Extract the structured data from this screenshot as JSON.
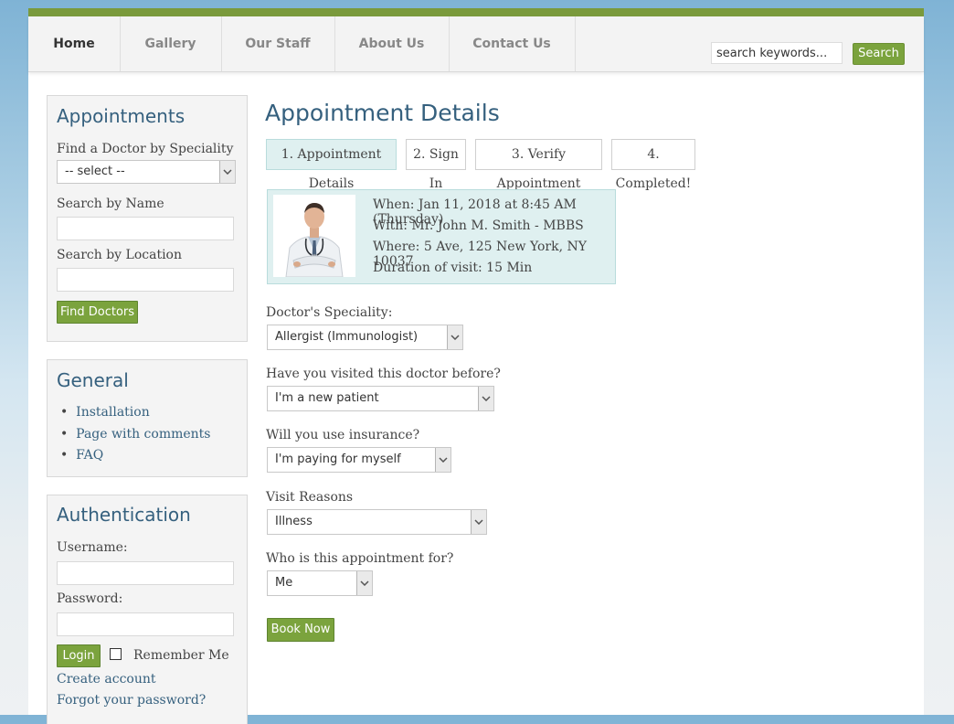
{
  "nav": {
    "items": [
      {
        "label": "Home"
      },
      {
        "label": "Gallery"
      },
      {
        "label": "Our Staff"
      },
      {
        "label": "About Us"
      },
      {
        "label": "Contact Us"
      }
    ],
    "search_value": "search keywords...",
    "search_button": "Search"
  },
  "sidebar": {
    "appointments": {
      "title": "Appointments",
      "speciality_label": "Find a Doctor by Speciality",
      "speciality_value": "-- select --",
      "name_label": "Search by Name",
      "location_label": "Search by Location",
      "find_button": "Find Doctors"
    },
    "general": {
      "title": "General",
      "links": [
        "Installation",
        "Page with comments",
        "FAQ"
      ]
    },
    "auth": {
      "title": "Authentication",
      "username_label": "Username:",
      "password_label": "Password:",
      "login_button": "Login",
      "remember_label": "Remember Me",
      "create_account": "Create account",
      "forgot_password": "Forgot your password?"
    }
  },
  "main": {
    "title": "Appointment Details",
    "steps": [
      "1. Appointment Details",
      "2. Sign In",
      "3. Verify Appointment",
      "4. Completed!"
    ],
    "info": {
      "when": "When: Jan 11, 2018 at 8:45 AM (Thursday)",
      "with": "With: Mr. John M. Smith - MBBS",
      "where": "Where: 5 Ave, 125 New York, NY 10037",
      "duration": "Duration of visit: 15 Min"
    },
    "form": {
      "speciality_label": "Doctor's Speciality:",
      "speciality_value": "Allergist (Immunologist)",
      "visited_label": "Have you visited this doctor before?",
      "visited_value": "I'm a new patient",
      "insurance_label": "Will you use insurance?",
      "insurance_value": "I'm paying for myself",
      "reason_label": "Visit Reasons",
      "reason_value": "Illness",
      "for_label": "Who is this appointment for?",
      "for_value": "Me",
      "book_button": "Book Now"
    }
  },
  "colors": {
    "accent_green": "#7ba33d",
    "heading_blue": "#35607e",
    "info_bg": "#dff0f0"
  }
}
